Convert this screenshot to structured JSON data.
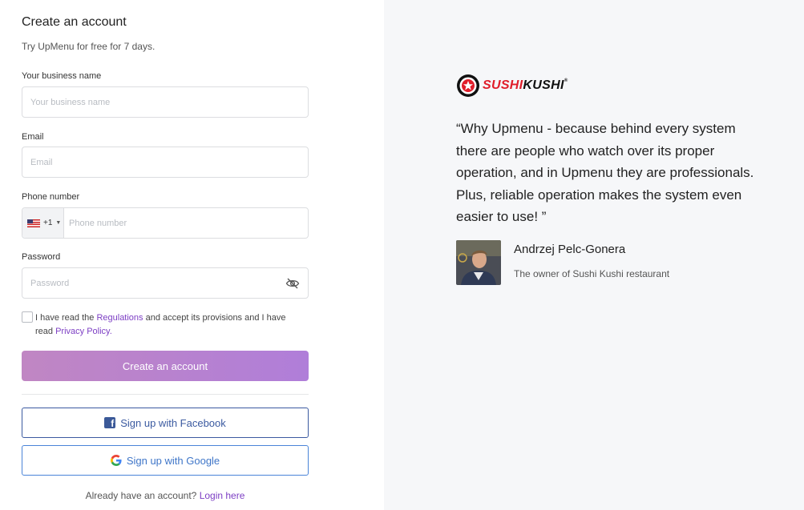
{
  "form": {
    "title": "Create an account",
    "subtitle": "Try UpMenu for free for 7 days.",
    "business_name": {
      "label": "Your business name",
      "placeholder": "Your business name"
    },
    "email": {
      "label": "Email",
      "placeholder": "Email"
    },
    "phone": {
      "label": "Phone number",
      "country_code": "+1",
      "placeholder": "Phone number"
    },
    "password": {
      "label": "Password",
      "placeholder": "Password"
    },
    "terms": {
      "text_before": "I have read the ",
      "regulations_link": "Regulations",
      "text_middle": " and accept its provisions and I have read ",
      "privacy_link": "Privacy Policy",
      "text_after": "."
    },
    "submit_label": "Create an account",
    "facebook_label": "Sign up with Facebook",
    "google_label": "Sign up with Google",
    "login_prompt": "Already have an account?",
    "login_link": "Login here"
  },
  "testimonial": {
    "logo_text_red": "SUSHI",
    "logo_text_dark": "KUSHI",
    "logo_reg": "®",
    "quote": "“Why Upmenu - because behind every system there are people who watch over its proper operation, and in Upmenu they are professionals. Plus, reliable operation makes the system even easier to use! ”",
    "author_name": "Andrzej Pelc-Gonera",
    "author_role": "The owner of Sushi Kushi restaurant"
  },
  "colors": {
    "accent": "#7d3fc4",
    "button_gradient_start": "#c086c3",
    "button_gradient_end": "#b07ed9",
    "facebook": "#3b5998",
    "brand_red": "#e01e2b"
  }
}
